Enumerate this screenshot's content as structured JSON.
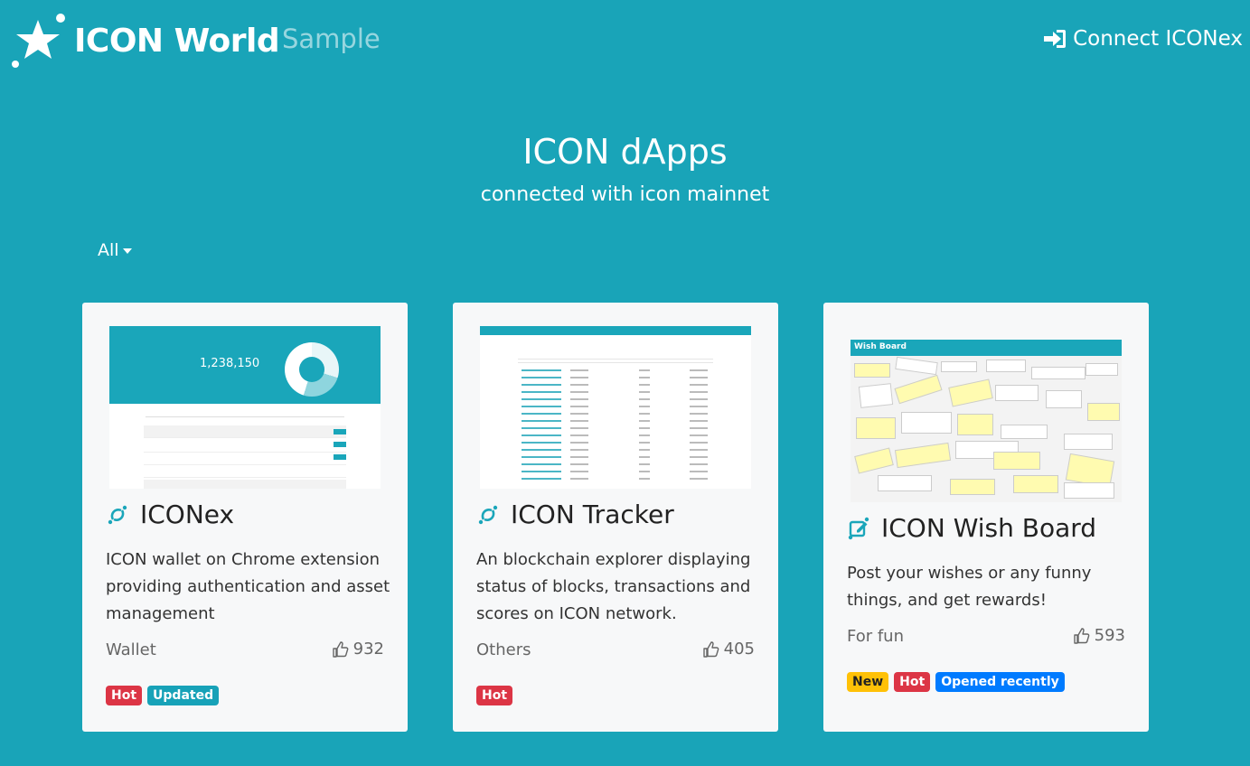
{
  "nav": {
    "brand": "ICON World",
    "brand_sub": "Sample",
    "connect_label": "Connect ICONex"
  },
  "hero": {
    "title": "ICON dApps",
    "subtitle": "connected with icon mainnet"
  },
  "filter": {
    "selected": "All"
  },
  "cards": [
    {
      "title": "ICONex",
      "description": "ICON wallet on Chrome extension providing authentication and asset management",
      "category": "Wallet",
      "likes": "932",
      "badges": [
        "Hot",
        "Updated"
      ],
      "icon": "icon-logo-icon",
      "thumb_amount": "1,238,150"
    },
    {
      "title": "ICON Tracker",
      "description": "An blockchain explorer displaying status of blocks, transactions and scores on ICON network.",
      "category": "Others",
      "likes": "405",
      "badges": [
        "Hot"
      ],
      "icon": "icon-logo-icon"
    },
    {
      "title": "ICON Wish Board",
      "description": "Post your wishes or any funny things, and get rewards!",
      "category": "For fun",
      "likes": "593",
      "badges": [
        "New",
        "Hot",
        "Opened recently"
      ],
      "icon": "edit-icon",
      "thumb_title": "Wish Board"
    }
  ],
  "colors": {
    "background": "#19a4b8",
    "card": "#f7f8f9",
    "hot": "#dc3545",
    "updated": "#17a2b8",
    "new": "#ffc107",
    "opened": "#007bff"
  }
}
